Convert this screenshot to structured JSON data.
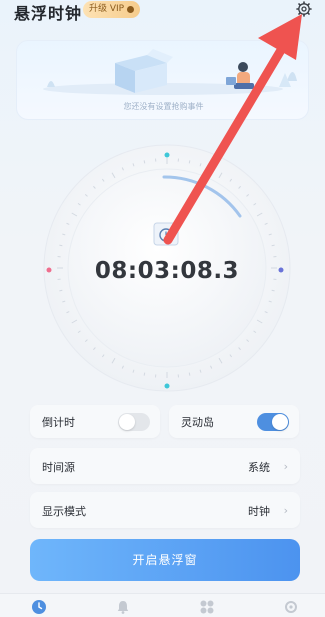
{
  "header": {
    "app_title": "悬浮时钟",
    "vip_label": "升级 VIP"
  },
  "banner": {
    "empty_text": "您还没有设置抢购事件"
  },
  "clock": {
    "time": "08:03:08.3"
  },
  "toggles": [
    {
      "label": "倒计时",
      "on": false
    },
    {
      "label": "灵动岛",
      "on": true
    }
  ],
  "settings": [
    {
      "label": "时间源",
      "value": "系统"
    },
    {
      "label": "显示模式",
      "value": "时钟"
    }
  ],
  "start_button": {
    "label": "开启悬浮窗"
  },
  "tabbar": {
    "tabs": [
      {
        "icon": "clock-icon",
        "active": true
      },
      {
        "icon": "bell-icon",
        "active": false
      },
      {
        "icon": "grid-icon",
        "active": false
      },
      {
        "icon": "gear-icon",
        "active": false
      }
    ]
  },
  "colors": {
    "accent": "#4e8fe0",
    "arrow": "#ef5350",
    "button_start": "#6fb6fb",
    "button_end": "#4c93ef"
  }
}
